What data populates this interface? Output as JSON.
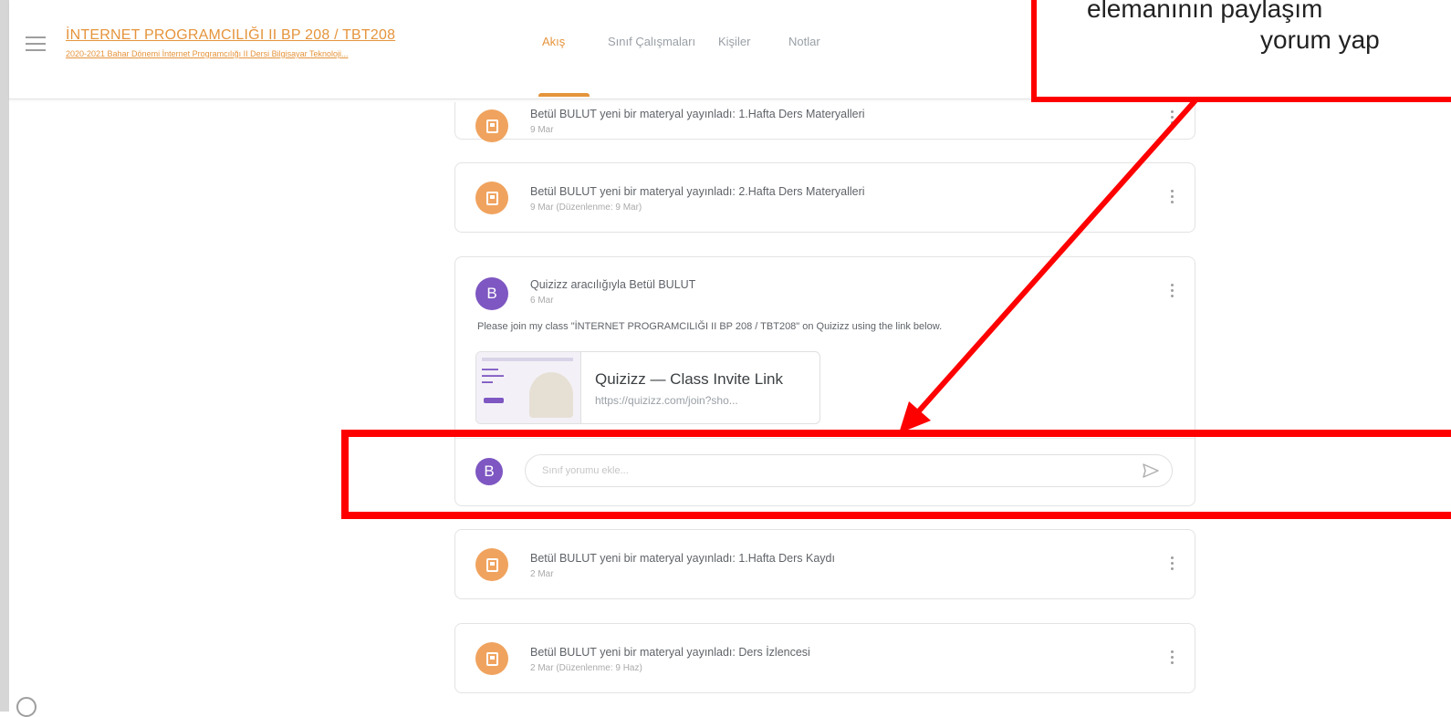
{
  "header": {
    "course_title": "İNTERNET PROGRAMCILIĞI II BP 208 / TBT208",
    "course_subtitle": "2020-2021 Bahar Dönemi İnternet Programcılığı II Dersi Bilgisayar Teknoloji...",
    "tabs": [
      {
        "label": "Akış",
        "active": true
      },
      {
        "label": "Sınıf Çalışmaları",
        "active": false
      },
      {
        "label": "Kişiler",
        "active": false
      },
      {
        "label": "Notlar",
        "active": false
      }
    ]
  },
  "annotation": {
    "line1": "elemanının paylaşım",
    "line2": "yorum yap",
    "color": "#ff0000"
  },
  "stream": {
    "posts": [
      {
        "icon": "material-icon",
        "title": "Betül BULUT yeni bir materyal yayınladı: 1.Hafta Ders Materyalleri",
        "date": "9 Mar"
      },
      {
        "icon": "material-icon",
        "title": "Betül BULUT yeni bir materyal yayınladı: 2.Hafta Ders Materyalleri",
        "date": "9 Mar (Düzenlenme: 9 Mar)"
      },
      {
        "icon": "user-avatar",
        "avatar_letter": "B",
        "title": "Quizizz aracılığıyla Betül BULUT",
        "date": "6 Mar",
        "body": "Please join my class \"İNTERNET PROGRAMCILIĞI II BP 208 / TBT208\" on Quizizz using the link below.",
        "attachment": {
          "title": "Quizizz — Class Invite Link",
          "url": "https://quizizz.com/join?sho..."
        },
        "comment": {
          "avatar_letter": "B",
          "placeholder": "Sınıf yorumu ekle..."
        }
      },
      {
        "icon": "material-icon",
        "title": "Betül BULUT yeni bir materyal yayınladı: 1.Hafta Ders Kaydı",
        "date": "2 Mar"
      },
      {
        "icon": "material-icon",
        "title": "Betül BULUT yeni bir materyal yayınladı: Ders İzlencesi",
        "date": "2 Mar (Düzenlenme: 9 Haz)"
      }
    ]
  },
  "colors": {
    "accent": "#e5943c",
    "material_avatar": "#f0a35e",
    "user_avatar": "#7e57c2",
    "highlight": "#ff0000"
  }
}
